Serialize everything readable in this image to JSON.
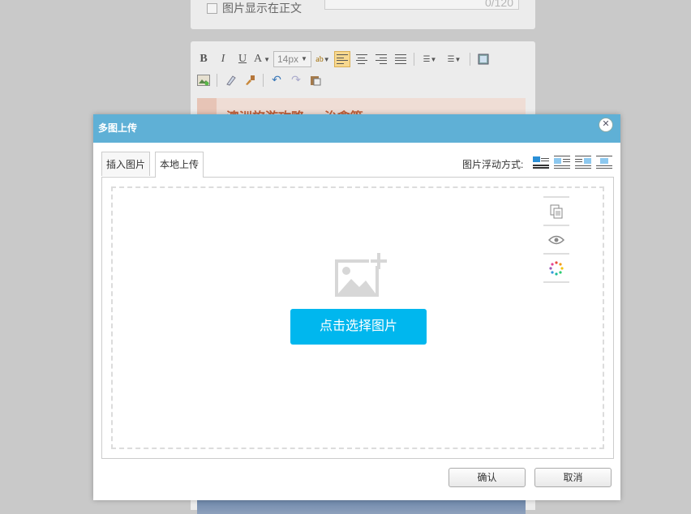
{
  "background": {
    "show_in_body_label": "图片显示在正文",
    "counter": "0/120",
    "font_size": "14px",
    "article_title": "澳洲旅游攻略 — 治愈篇"
  },
  "dialog": {
    "title": "多图上传",
    "close_icon": "close-icon",
    "tabs": [
      {
        "label": "插入图片"
      },
      {
        "label": "本地上传"
      }
    ],
    "float_label": "图片浮动方式:",
    "float_options": [
      "float-none-icon",
      "float-left-icon",
      "float-right-icon",
      "float-center-icon"
    ],
    "side_tools": [
      "copy-icon",
      "preview-icon",
      "color-wheel-icon"
    ],
    "choose_button": "点击选择图片",
    "ok_button": "确认",
    "cancel_button": "取消"
  },
  "colors": {
    "title_bar": "#5fb0d6",
    "choose_button": "#00b7ee",
    "float_accent": "#2a8fd6"
  }
}
